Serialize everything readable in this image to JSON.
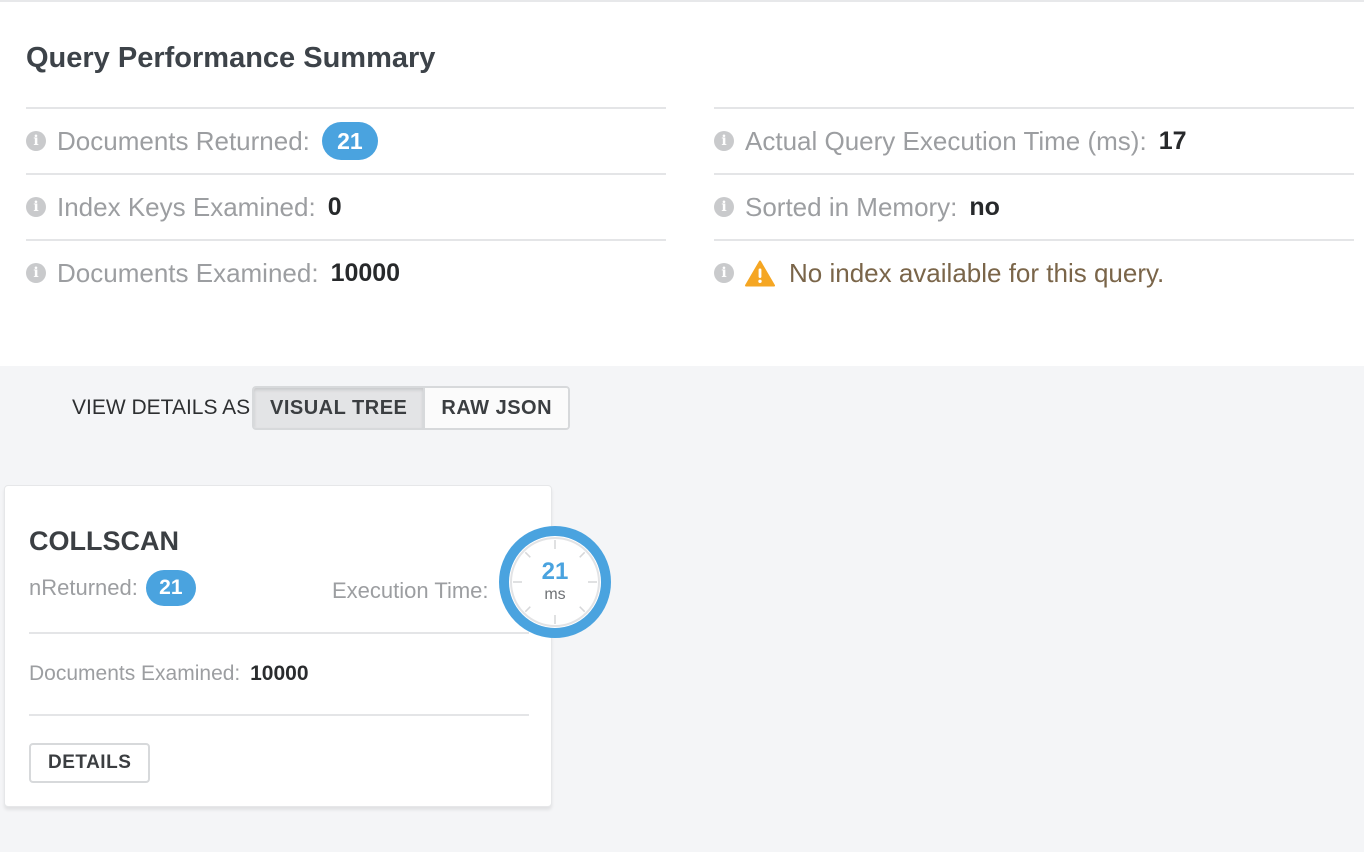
{
  "summary": {
    "title": "Query Performance Summary",
    "left_rows": [
      {
        "label": "Documents Returned:",
        "value": "21",
        "style": "pill"
      },
      {
        "label": "Index Keys Examined:",
        "value": "0",
        "style": "bold"
      },
      {
        "label": "Documents Examined:",
        "value": "10000",
        "style": "bold"
      }
    ],
    "right_rows": [
      {
        "label": "Actual Query Execution Time (ms):",
        "value": "17"
      },
      {
        "label": "Sorted in Memory:",
        "value": "no"
      }
    ],
    "warning": {
      "text": "No index available for this query.",
      "icon": "warning-triangle-icon"
    },
    "info_icon_glyph": "i"
  },
  "view_toggle": {
    "label": "VIEW DETAILS AS",
    "options": [
      "VISUAL TREE",
      "RAW JSON"
    ],
    "selected": "VISUAL TREE"
  },
  "stage": {
    "name": "COLLSCAN",
    "nreturned_label": "nReturned:",
    "nreturned_value": "21",
    "exec_time_label": "Execution Time:",
    "exec_time_value": "21",
    "exec_time_unit": "ms",
    "docs_examined_label": "Documents Examined:",
    "docs_examined_value": "10000",
    "details_button": "DETAILS"
  },
  "colors": {
    "accent_blue": "#4aa3df",
    "warning_yellow": "#f5a623",
    "warning_text": "#7a6549",
    "muted_text": "#9c9ea1",
    "info_icon": "#c9cacc"
  }
}
